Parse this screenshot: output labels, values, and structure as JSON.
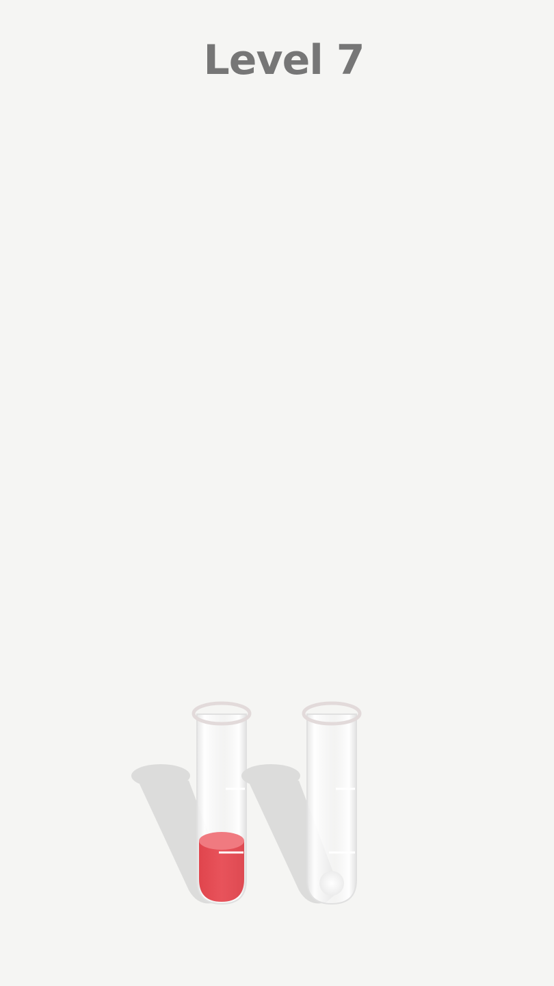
{
  "header": {
    "level_label": "Level 7"
  },
  "colors": {
    "background": "#f5f5f3",
    "title": "#767676",
    "liquid_red": "#e8535b",
    "liquid_red_light": "#f07a80",
    "glass_rim": "#e2dada",
    "shadow": "#dcdcdb"
  },
  "tubes": [
    {
      "name": "tube-1",
      "capacity_segments": 3,
      "fill_segments": 1,
      "liquid": "red"
    },
    {
      "name": "tube-2",
      "capacity_segments": 3,
      "fill_segments": 0,
      "liquid": "none"
    }
  ]
}
